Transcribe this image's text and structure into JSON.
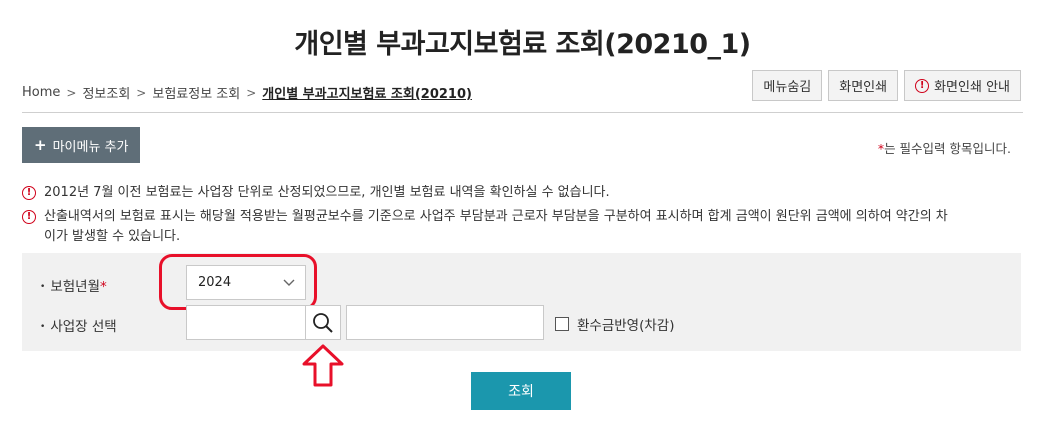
{
  "page": {
    "title": "개인별 부과고지보험료 조회(20210_1)"
  },
  "breadcrumb": {
    "items": [
      "Home",
      "정보조회",
      "보험료정보 조회"
    ],
    "current": "개인별 부과고지보험료 조회(20210)"
  },
  "toolbar": {
    "hide_menu_label": "메뉴숨김",
    "print_label": "화면인쇄",
    "print_guide_label": "화면인쇄 안내"
  },
  "add_my_menu": {
    "label": "마이메뉴 추가"
  },
  "required_note": {
    "star": "*",
    "text": "는 필수입력 항목입니다."
  },
  "notices": [
    "2012년 7월 이전 보험료는 사업장 단위로 산정되었으므로, 개인별 보험료 내역을 확인하실 수 없습니다.",
    "산출내역서의 보험료 표시는 해당월 적용받는 월평균보수를 기준으로 사업주 부담분과 근로자 부담분을 구분하여 표시하며 합계 금액이 원단위 금액에 의하여 약간의 차",
    "이가 발생할 수 있습니다."
  ],
  "form": {
    "year_label": "보험년월",
    "year_required": "*",
    "year_value": "2024",
    "workplace_label": "사업장 선택",
    "workplace_code_value": "",
    "workplace_name_value": "",
    "refund_checkbox_label": "환수금반영(차감)",
    "refund_checked": false
  },
  "submit": {
    "label": "조회"
  },
  "colors": {
    "accent": "#1b97ad",
    "highlight": "#e8102a",
    "warning": "#d0021b",
    "add_menu_bg": "#5f6e78"
  },
  "icons": {
    "breadcrumb_separator": "chevron-right-icon",
    "warning": "exclamation-circle-icon",
    "search": "search-icon",
    "select_arrow": "chevron-down-icon",
    "pointer": "up-arrow-icon"
  }
}
